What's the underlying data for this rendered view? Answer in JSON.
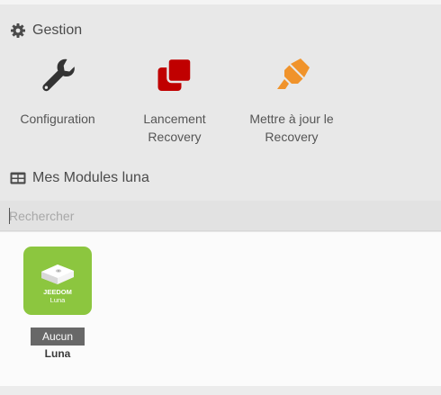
{
  "gestion": {
    "title": "Gestion",
    "icon": "gear-icon",
    "actions": [
      {
        "label": "Configuration",
        "icon": "wrench-icon",
        "color": "#333333"
      },
      {
        "label": "Lancement\nRecovery",
        "icon": "copy-squares-icon",
        "color": "#c00000"
      },
      {
        "label": "Mettre à jour le\nRecovery",
        "icon": "highlighter-icon",
        "color": "#f0932b"
      }
    ]
  },
  "modules": {
    "title": "Mes Modules luna",
    "icon": "table-icon",
    "search_placeholder": "Rechercher",
    "items": [
      {
        "logo_text_1": "JEEDOM",
        "logo_text_2": "Luna",
        "badge": "Aucun",
        "name": "Luna",
        "thumb_color": "#8cc63f"
      }
    ]
  }
}
